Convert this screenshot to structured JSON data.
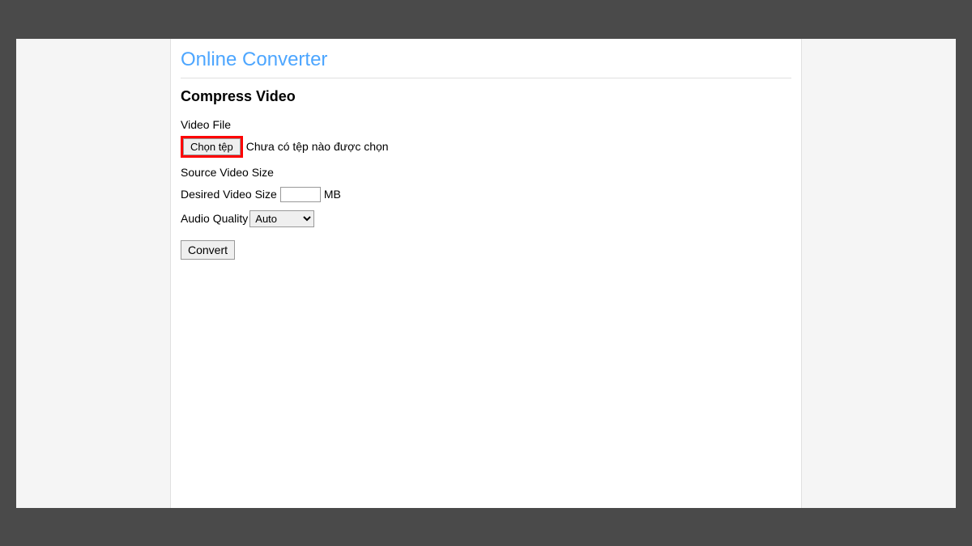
{
  "site": {
    "title": "Online Converter"
  },
  "page": {
    "heading": "Compress Video"
  },
  "form": {
    "video_file_label": "Video File",
    "choose_file_button": "Chọn tệp",
    "no_file_text": "Chưa có tệp nào được chọn",
    "source_size_label": "Source Video Size",
    "desired_size_label": "Desired Video Size",
    "desired_size_value": "",
    "size_unit": "MB",
    "audio_quality_label": "Audio Quality",
    "audio_quality_selected": "Auto",
    "convert_button": "Convert"
  }
}
